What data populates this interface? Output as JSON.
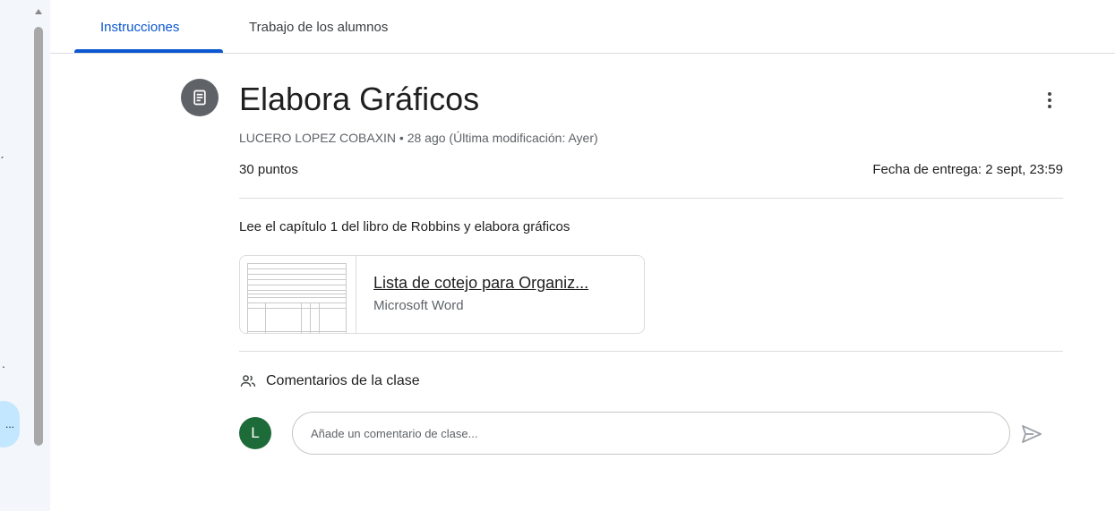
{
  "tabs": [
    {
      "label": "Instrucciones",
      "active": true
    },
    {
      "label": "Trabajo de los alumnos",
      "active": false
    }
  ],
  "assignment": {
    "icon": "assignment-icon",
    "title": "Elabora Gráficos",
    "meta": "LUCERO LOPEZ COBAXIN • 28 ago (Última modificación: Ayer)",
    "points": "30 puntos",
    "due": "Fecha de entrega: 2 sept, 23:59",
    "description": "Lee el capítulo 1 del libro de Robbins y elabora gráficos"
  },
  "attachment": {
    "title": "Lista de cotejo para Organiz...",
    "type": "Microsoft Word"
  },
  "comments": {
    "heading": "Comentarios de la clase",
    "avatar_letter": "L",
    "placeholder": "Añade un comentario de clase...",
    "avatar_color": "#1e6b3a"
  },
  "sidebar": {
    "bubble_text": "..."
  },
  "colors": {
    "accent": "#0b57d0",
    "icon_bg": "#5f6368"
  }
}
